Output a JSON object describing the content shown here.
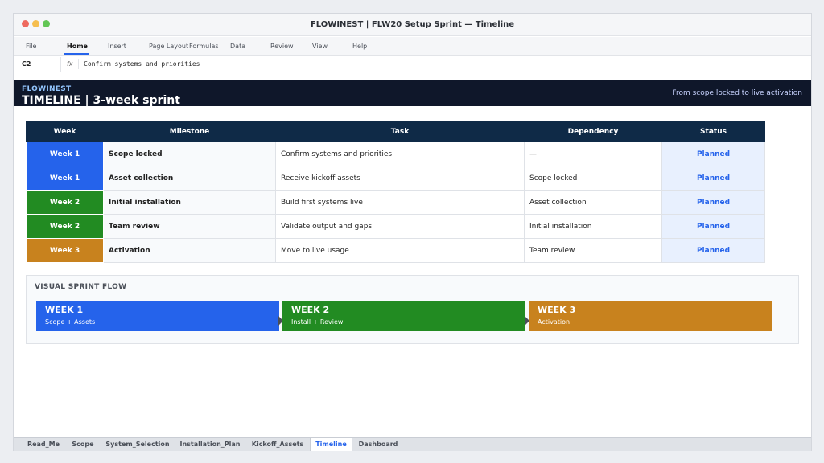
{
  "window": {
    "title": "FLOWINEST | FLW20 Setup Sprint — Timeline",
    "controls": {
      "close_color": "#ee6a5f",
      "minimize_color": "#f5be4f",
      "maximize_color": "#62c655"
    }
  },
  "menu": {
    "items": [
      {
        "label": "File"
      },
      {
        "label": "Home",
        "active": true
      },
      {
        "label": "Insert"
      },
      {
        "label": "Page Layout"
      },
      {
        "label": "Formulas"
      },
      {
        "label": "Data"
      },
      {
        "label": "Review"
      },
      {
        "label": "View"
      },
      {
        "label": "Help"
      }
    ]
  },
  "formula_bar": {
    "cell_ref": "C2",
    "fx_label": "fx",
    "value": "Confirm systems and priorities"
  },
  "banner": {
    "brand": "FLOWINEST",
    "title": "TIMELINE | 3-week sprint",
    "subtitle": "From scope locked to live activation"
  },
  "table": {
    "headers": [
      "Week",
      "Milestone",
      "Task",
      "Dependency",
      "Status"
    ],
    "rows": [
      {
        "week": "Week 1",
        "milestone": "Scope locked",
        "task": "Confirm systems and priorities",
        "dependency": "—",
        "status": "Planned"
      },
      {
        "week": "Week 1",
        "milestone": "Asset collection",
        "task": "Receive kickoff assets",
        "dependency": "Scope locked",
        "status": "Planned"
      },
      {
        "week": "Week 2",
        "milestone": "Initial installation",
        "task": "Build first systems live",
        "dependency": "Asset collection",
        "status": "Planned"
      },
      {
        "week": "Week 2",
        "milestone": "Team review",
        "task": "Validate output and gaps",
        "dependency": "Initial installation",
        "status": "Planned"
      },
      {
        "week": "Week 3",
        "milestone": "Activation",
        "task": "Move to live usage",
        "dependency": "Team review",
        "status": "Planned"
      }
    ]
  },
  "flow": {
    "title": "VISUAL SPRINT FLOW",
    "blocks": [
      {
        "week": "WEEK 1",
        "label": "Scope + Assets"
      },
      {
        "week": "WEEK 2",
        "label": "Install + Review"
      },
      {
        "week": "WEEK 3",
        "label": "Activation"
      }
    ]
  },
  "sheet_tabs": [
    {
      "label": "Read_Me"
    },
    {
      "label": "Scope"
    },
    {
      "label": "System_Selection"
    },
    {
      "label": "Installation_Plan"
    },
    {
      "label": "Kickoff_Assets"
    },
    {
      "label": "Timeline",
      "active": true
    },
    {
      "label": "Dashboard"
    }
  ],
  "colors": {
    "accent": "#2563eb",
    "week1": "#2563eb",
    "week2": "#228b22",
    "week3": "#c8821e",
    "header_dark": "#0f172a",
    "table_header": "#0f2a47",
    "status_text": "#2563eb"
  }
}
